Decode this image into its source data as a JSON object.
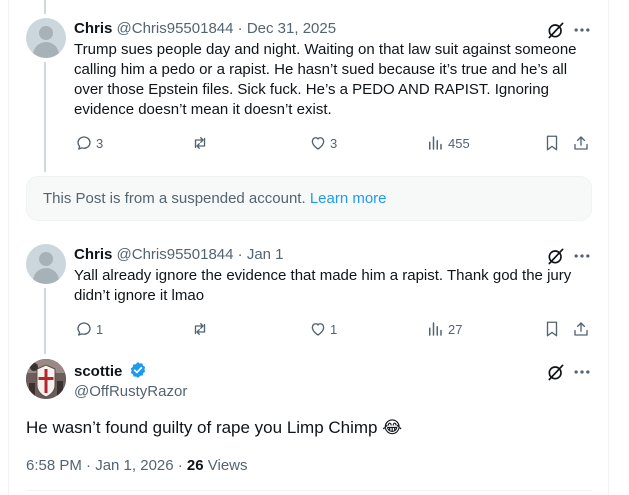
{
  "replies": [
    {
      "author_name": "Chris",
      "handle": "@Chris95501844",
      "separator": "·",
      "date": "Dec 31, 2025",
      "text": "Trump sues people day and night. Waiting on that law suit against someone calling him a pedo or a rapist. He hasn’t sued because it’s true and he’s all over those Epstein files. Sick fuck. He’s a PEDO AND RAPIST. Ignoring evidence doesn’t mean it doesn’t exist.",
      "text_lines": [
        "Trump sues people day and night. Waiting on that law suit against someone",
        "calling him a pedo or a rapist. He hasn’t sued because it’s true and he’s all",
        "over those Epstein files. Sick fuck. He’s a PEDO AND RAPIST. Ignoring",
        "evidence doesn’t mean it doesn’t exist."
      ],
      "replies": "3",
      "likes": "3",
      "views": "455"
    },
    {
      "author_name": "Chris",
      "handle": "@Chris95501844",
      "separator": "·",
      "date": "Jan 1",
      "text_lines": [
        "Yall already ignore the evidence that made him a rapist. Thank god the jury",
        "didn’t ignore it lmao"
      ],
      "replies": "1",
      "likes": "1",
      "views": "27"
    }
  ],
  "suspended_notice": {
    "text": "This Post is from a suspended account.",
    "link": "Learn more"
  },
  "main_post": {
    "author_name": "scottie",
    "handle": "@OffRustyRazor",
    "verified": true,
    "text": "He wasn’t found guilty of rape you Limp Chimp 😂",
    "time": "6:58 PM · Jan 1, 2026 · ",
    "views_count": "26",
    "views_label": " Views"
  },
  "colors": {
    "text": "#0f1419",
    "muted": "#536471",
    "link": "#1d9bf0",
    "verified": "#1d9bf0"
  },
  "icons": {
    "reply": "reply-icon",
    "repost": "repost-icon",
    "like": "like-icon",
    "views": "views-icon",
    "bookmark": "bookmark-icon",
    "share": "share-icon",
    "grok": "grok-icon",
    "more": "more-icon"
  }
}
